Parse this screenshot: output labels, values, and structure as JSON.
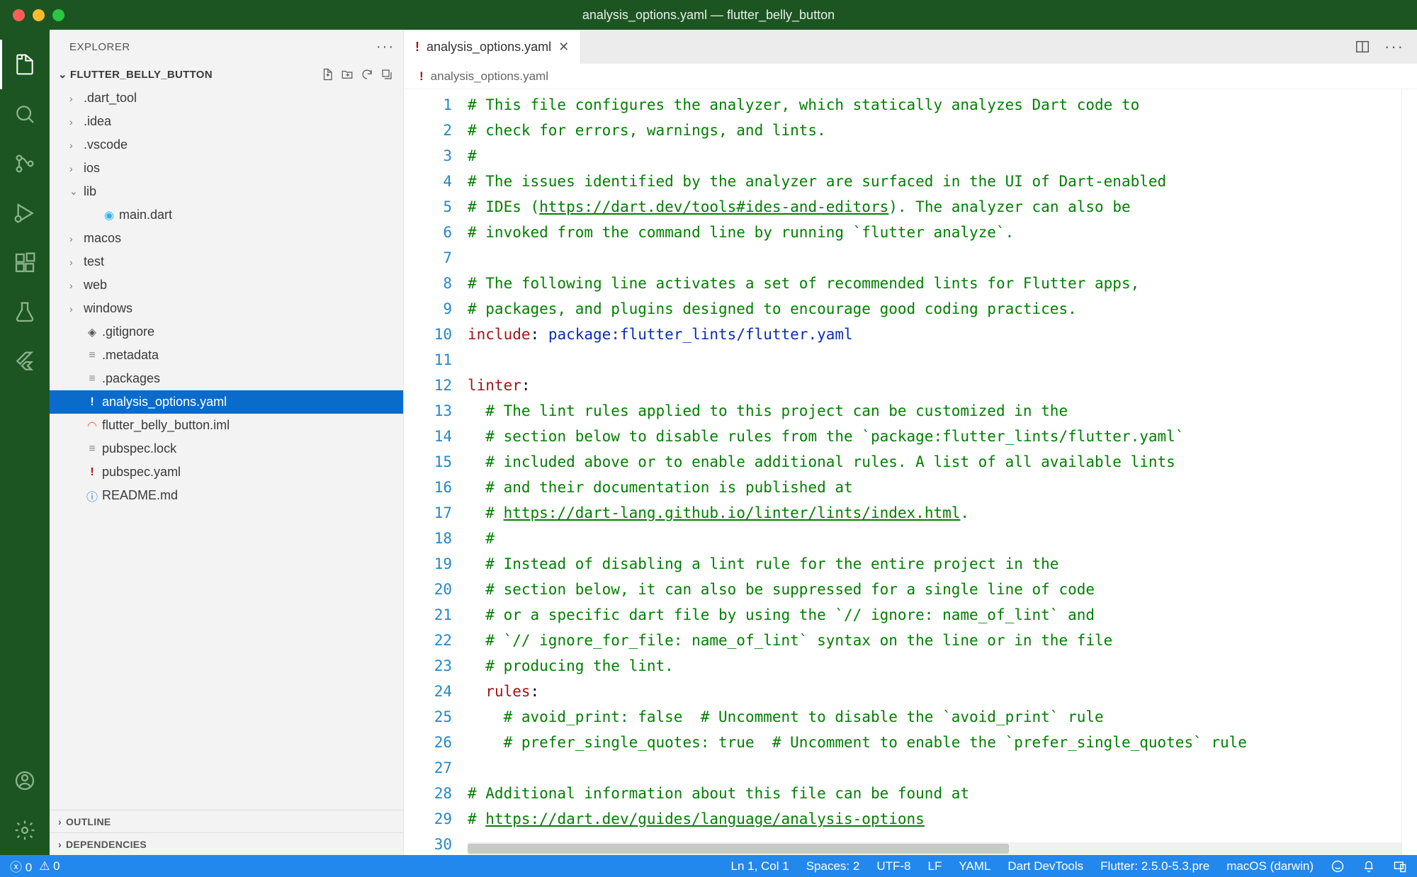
{
  "window": {
    "title": "analysis_options.yaml — flutter_belly_button"
  },
  "sidebar": {
    "title": "EXPLORER",
    "project": "FLUTTER_BELLY_BUTTON",
    "tree": [
      {
        "type": "folder",
        "label": ".dart_tool",
        "depth": 1,
        "open": false
      },
      {
        "type": "folder",
        "label": ".idea",
        "depth": 1,
        "open": false
      },
      {
        "type": "folder",
        "label": ".vscode",
        "depth": 1,
        "open": false
      },
      {
        "type": "folder",
        "label": "ios",
        "depth": 1,
        "open": false
      },
      {
        "type": "folder",
        "label": "lib",
        "depth": 1,
        "open": true
      },
      {
        "type": "file",
        "label": "main.dart",
        "depth": 2,
        "icon": "dart"
      },
      {
        "type": "folder",
        "label": "macos",
        "depth": 1,
        "open": false
      },
      {
        "type": "folder",
        "label": "test",
        "depth": 1,
        "open": false
      },
      {
        "type": "folder",
        "label": "web",
        "depth": 1,
        "open": false
      },
      {
        "type": "folder",
        "label": "windows",
        "depth": 1,
        "open": false
      },
      {
        "type": "file",
        "label": ".gitignore",
        "depth": 1,
        "icon": "git"
      },
      {
        "type": "file",
        "label": ".metadata",
        "depth": 1,
        "icon": "lines"
      },
      {
        "type": "file",
        "label": ".packages",
        "depth": 1,
        "icon": "lines"
      },
      {
        "type": "file",
        "label": "analysis_options.yaml",
        "depth": 1,
        "icon": "bang",
        "selected": true
      },
      {
        "type": "file",
        "label": "flutter_belly_button.iml",
        "depth": 1,
        "icon": "rss"
      },
      {
        "type": "file",
        "label": "pubspec.lock",
        "depth": 1,
        "icon": "lines"
      },
      {
        "type": "file",
        "label": "pubspec.yaml",
        "depth": 1,
        "icon": "bang"
      },
      {
        "type": "file",
        "label": "README.md",
        "depth": 1,
        "icon": "info"
      }
    ],
    "outline": "OUTLINE",
    "dependencies": "DEPENDENCIES"
  },
  "tabs": {
    "open": [
      {
        "label": "analysis_options.yaml"
      }
    ]
  },
  "breadcrumb": {
    "file": "analysis_options.yaml"
  },
  "editor": {
    "lines": [
      {
        "n": 1,
        "t": "comment",
        "text": "# This file configures the analyzer, which statically analyzes Dart code to"
      },
      {
        "n": 2,
        "t": "comment",
        "text": "# check for errors, warnings, and lints."
      },
      {
        "n": 3,
        "t": "comment",
        "text": "#"
      },
      {
        "n": 4,
        "t": "comment",
        "text": "# The issues identified by the analyzer are surfaced in the UI of Dart-enabled"
      },
      {
        "n": 5,
        "t": "comment_link",
        "pre": "# IDEs (",
        "link": "https://dart.dev/tools#ides-and-editors",
        "post": "). The analyzer can also be"
      },
      {
        "n": 6,
        "t": "comment",
        "text": "# invoked from the command line by running `flutter analyze`."
      },
      {
        "n": 7,
        "t": "blank",
        "text": ""
      },
      {
        "n": 8,
        "t": "comment",
        "text": "# The following line activates a set of recommended lints for Flutter apps,"
      },
      {
        "n": 9,
        "t": "comment",
        "text": "# packages, and plugins designed to encourage good coding practices."
      },
      {
        "n": 10,
        "t": "kv",
        "key": "include",
        "value": "package:flutter_lints/flutter.yaml"
      },
      {
        "n": 11,
        "t": "blank",
        "text": ""
      },
      {
        "n": 12,
        "t": "key",
        "key": "linter",
        "text": ":"
      },
      {
        "n": 13,
        "t": "comment",
        "indent": 1,
        "text": "# The lint rules applied to this project can be customized in the"
      },
      {
        "n": 14,
        "t": "comment",
        "indent": 1,
        "text": "# section below to disable rules from the `package:flutter_lints/flutter.yaml`"
      },
      {
        "n": 15,
        "t": "comment",
        "indent": 1,
        "text": "# included above or to enable additional rules. A list of all available lints"
      },
      {
        "n": 16,
        "t": "comment",
        "indent": 1,
        "text": "# and their documentation is published at"
      },
      {
        "n": 17,
        "t": "comment_link",
        "indent": 1,
        "pre": "# ",
        "link": "https://dart-lang.github.io/linter/lints/index.html",
        "post": "."
      },
      {
        "n": 18,
        "t": "comment",
        "indent": 1,
        "text": "#"
      },
      {
        "n": 19,
        "t": "comment",
        "indent": 1,
        "text": "# Instead of disabling a lint rule for the entire project in the"
      },
      {
        "n": 20,
        "t": "comment",
        "indent": 1,
        "text": "# section below, it can also be suppressed for a single line of code"
      },
      {
        "n": 21,
        "t": "comment",
        "indent": 1,
        "text": "# or a specific dart file by using the `// ignore: name_of_lint` and"
      },
      {
        "n": 22,
        "t": "comment",
        "indent": 1,
        "text": "# `// ignore_for_file: name_of_lint` syntax on the line or in the file"
      },
      {
        "n": 23,
        "t": "comment",
        "indent": 1,
        "text": "# producing the lint."
      },
      {
        "n": 24,
        "t": "key",
        "indent": 1,
        "key": "rules",
        "text": ":"
      },
      {
        "n": 25,
        "t": "comment",
        "indent": 2,
        "text": "# avoid_print: false  # Uncomment to disable the `avoid_print` rule"
      },
      {
        "n": 26,
        "t": "comment",
        "indent": 2,
        "text": "# prefer_single_quotes: true  # Uncomment to enable the `prefer_single_quotes` rule"
      },
      {
        "n": 27,
        "t": "blank",
        "text": ""
      },
      {
        "n": 28,
        "t": "comment",
        "text": "# Additional information about this file can be found at"
      },
      {
        "n": 29,
        "t": "comment_link",
        "pre": "# ",
        "link": "https://dart.dev/guides/language/analysis-options",
        "post": ""
      },
      {
        "n": 30,
        "t": "blank",
        "text": ""
      }
    ]
  },
  "status": {
    "errors": "0",
    "warnings": "0",
    "cursor": "Ln 1, Col 1",
    "spaces": "Spaces: 2",
    "encoding": "UTF-8",
    "eol": "LF",
    "lang": "YAML",
    "devtools": "Dart DevTools",
    "flutter": "Flutter: 2.5.0-5.3.pre",
    "platform": "macOS (darwin)"
  }
}
